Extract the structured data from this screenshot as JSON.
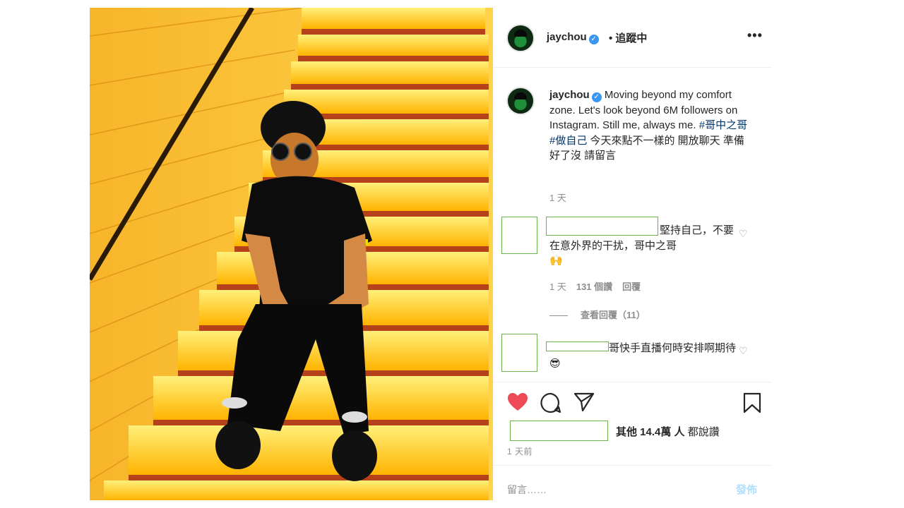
{
  "post": {
    "author": "jaychou",
    "follow_status": "• 追蹤中",
    "more": "•••",
    "caption_text": "Moving beyond my comfort zone. Let's look beyond 6M followers on Instagram. Still me, always me. ",
    "hashtags": [
      "#哥中之哥",
      "#做自己"
    ],
    "caption_tail": " 今天來點不一樣的 開放聊天 準備好了沒 請留言",
    "caption_time": "1 天"
  },
  "comments": [
    {
      "text": "堅持自己，不要在意外界的干扰，哥中之哥",
      "emoji": "🙌",
      "time": "1 天",
      "likes": "131 個讚",
      "reply": "回覆",
      "view_replies": "查看回覆（11）"
    },
    {
      "text": "哥快手直播何時安排啊期待",
      "emoji": "😎"
    }
  ],
  "footer": {
    "likes_text": "其他 14.4萬 人",
    "likes_suffix": " 都說讚",
    "post_time": "1 天前",
    "comment_placeholder": "留言……",
    "post_button": "發佈"
  },
  "colors": {
    "like": "#ed4956",
    "link": "#00376b",
    "verified": "#3897f0",
    "post_button": "#b2dffc",
    "redaction_border": "#6ab04c"
  },
  "icons": [
    "heart-icon",
    "comment-icon",
    "share-icon",
    "bookmark-icon",
    "verified-badge-icon",
    "more-options-icon"
  ]
}
